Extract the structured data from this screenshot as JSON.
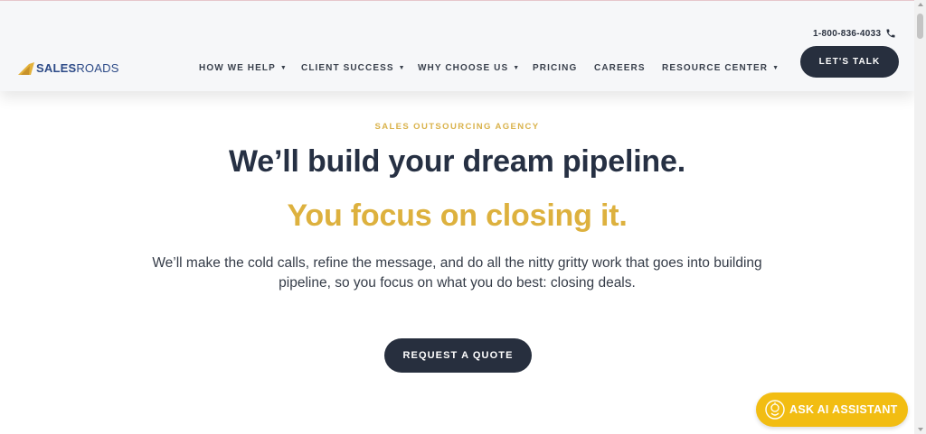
{
  "header": {
    "logo": {
      "sales": "SALES",
      "roads": "ROADS"
    },
    "phone": "1-800-836-4033",
    "nav": [
      {
        "label": "HOW WE HELP",
        "dropdown": true
      },
      {
        "label": "CLIENT SUCCESS",
        "dropdown": true
      },
      {
        "label": "WHY CHOOSE US",
        "dropdown": true
      },
      {
        "label": "PRICING",
        "dropdown": false
      },
      {
        "label": "CAREERS",
        "dropdown": false
      },
      {
        "label": "RESOURCE CENTER",
        "dropdown": true
      }
    ],
    "cta": "LET'S TALK"
  },
  "hero": {
    "eyebrow": "SALES OUTSOURCING AGENCY",
    "headline": "We’ll build your dream pipeline.",
    "subheadline": "You focus on closing it.",
    "lead_line1": "We’ll make the cold calls, refine the message, and do all the nitty gritty work that goes into building",
    "lead_line2": "pipeline, so you focus on what you do best: closing deals.",
    "cta": "REQUEST A QUOTE"
  },
  "assistant": {
    "label": "ASK AI ASSISTANT",
    "icon": "ai-assistant-icon"
  },
  "colors": {
    "accent": "#ddb13e",
    "dark": "#272f3e",
    "assistant": "#f2bd12",
    "logo_blue": "#2c4a87"
  }
}
